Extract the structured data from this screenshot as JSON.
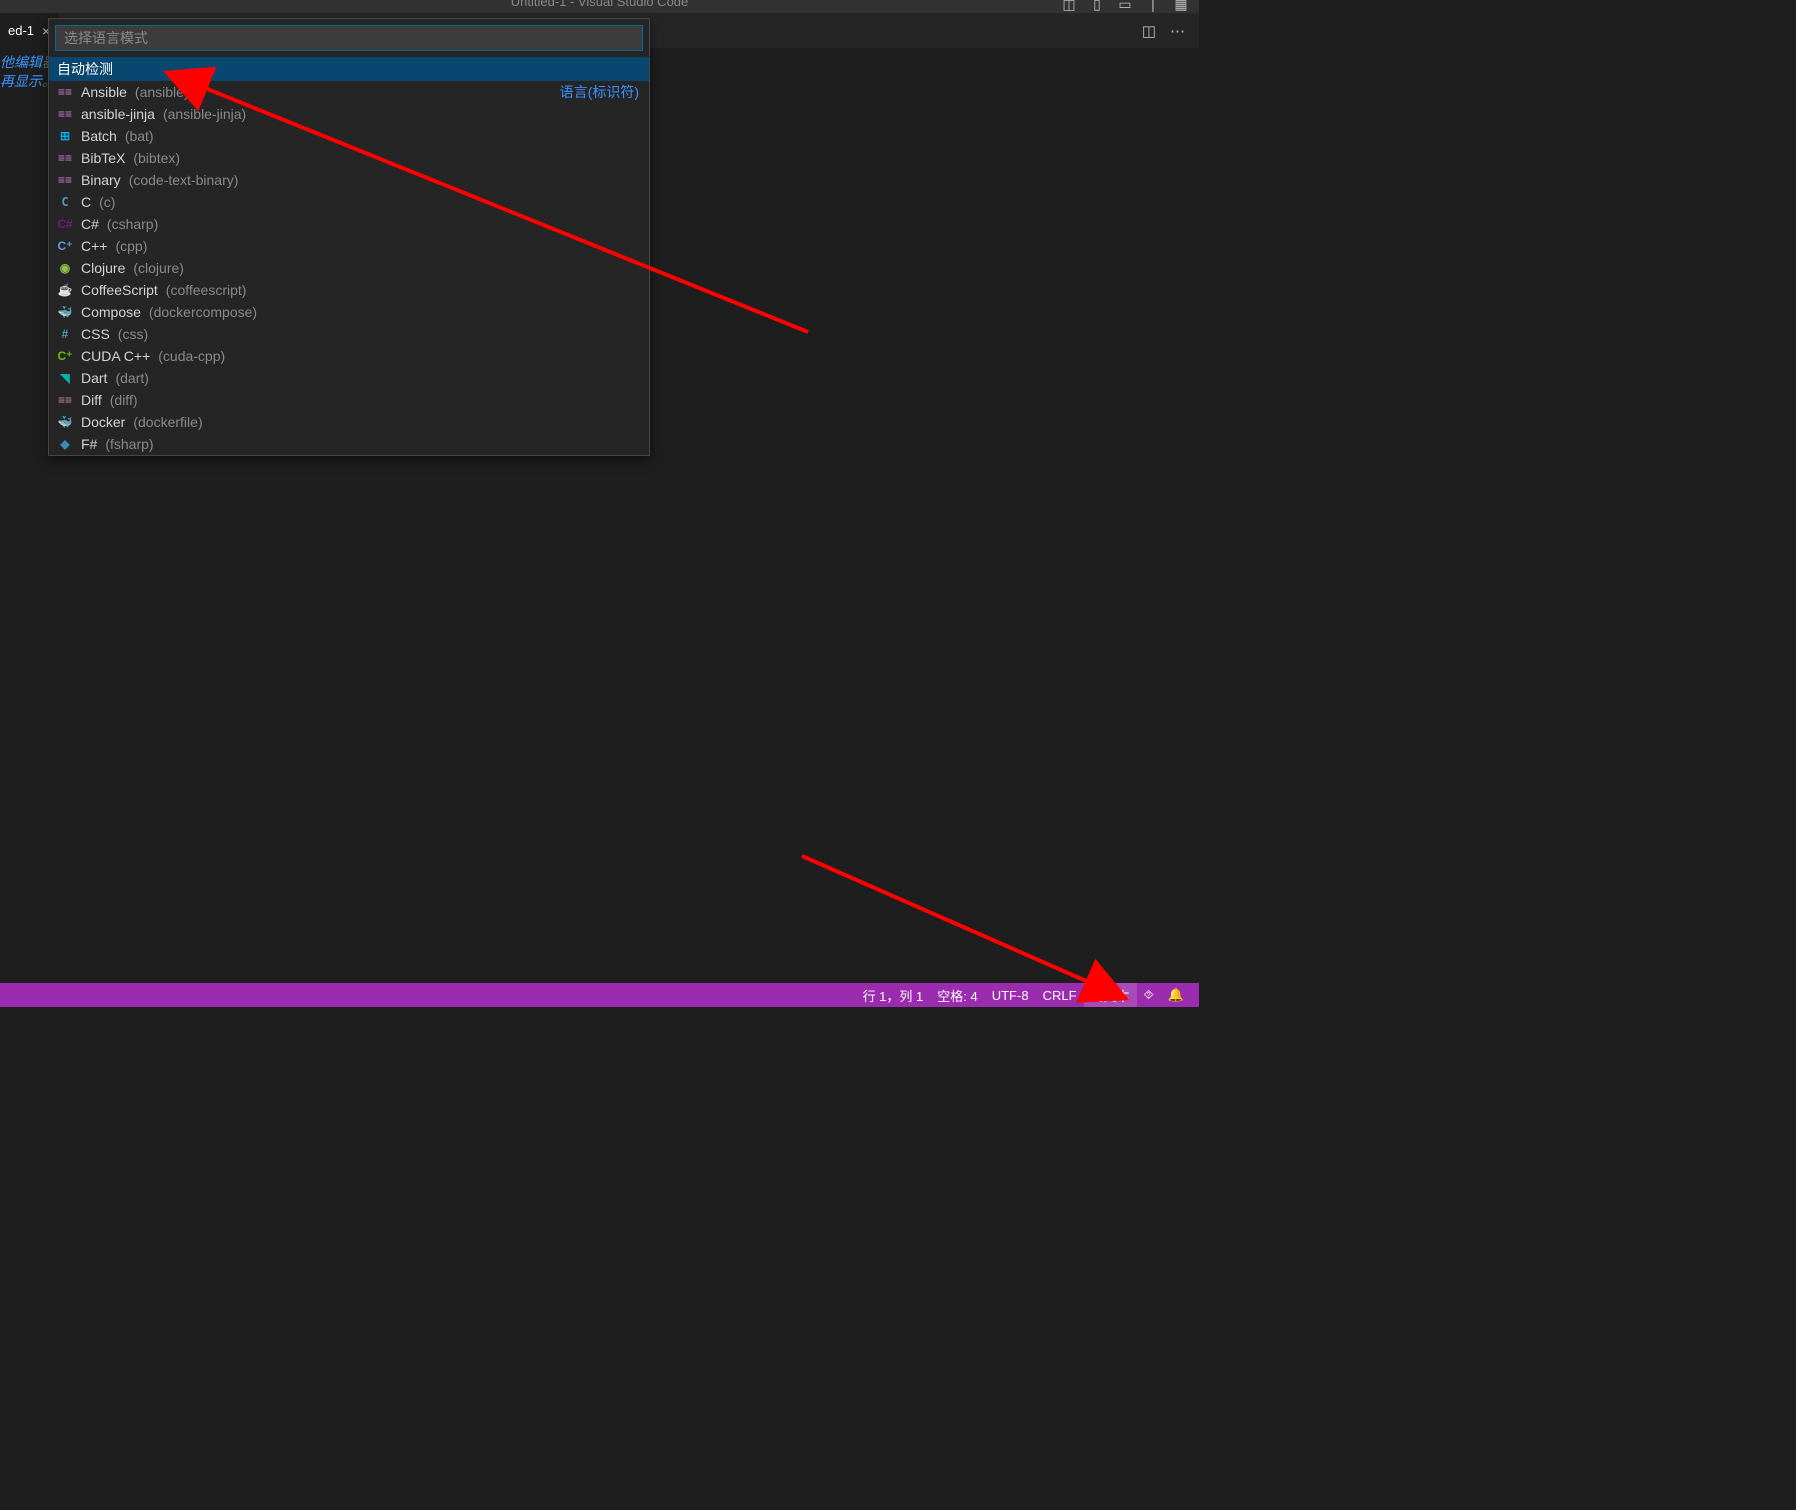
{
  "window": {
    "title": "Untitled-1 - Visual Studio Code"
  },
  "tab": {
    "name": "ed-1",
    "close": "×"
  },
  "editor_hint": {
    "line1_a": "他编辑",
    "line1_b": "器",
    "line2_a": "再显示",
    "line2_b": "。"
  },
  "quickpick": {
    "placeholder": "选择语言模式",
    "header": "自动检测",
    "right_label": "语言(标识符)",
    "items": [
      {
        "icon": "text",
        "name": "Ansible",
        "id": "(ansible)"
      },
      {
        "icon": "text",
        "name": "ansible-jinja",
        "id": "(ansible-jinja)"
      },
      {
        "icon": "bat",
        "name": "Batch",
        "id": "(bat)"
      },
      {
        "icon": "text",
        "name": "BibTeX",
        "id": "(bibtex)"
      },
      {
        "icon": "text",
        "name": "Binary",
        "id": "(code-text-binary)"
      },
      {
        "icon": "c",
        "name": "C",
        "id": "(c)"
      },
      {
        "icon": "csharp",
        "name": "C#",
        "id": "(csharp)"
      },
      {
        "icon": "cpp",
        "name": "C++",
        "id": "(cpp)"
      },
      {
        "icon": "clj",
        "name": "Clojure",
        "id": "(clojure)"
      },
      {
        "icon": "coffee",
        "name": "CoffeeScript",
        "id": "(coffeescript)"
      },
      {
        "icon": "docker",
        "name": "Compose",
        "id": "(dockercompose)"
      },
      {
        "icon": "css",
        "name": "CSS",
        "id": "(css)"
      },
      {
        "icon": "cuda",
        "name": "CUDA C++",
        "id": "(cuda-cpp)"
      },
      {
        "icon": "dart",
        "name": "Dart",
        "id": "(dart)"
      },
      {
        "icon": "text",
        "name": "Diff",
        "id": "(diff)"
      },
      {
        "icon": "docker",
        "name": "Docker",
        "id": "(dockerfile)"
      },
      {
        "icon": "fsharp",
        "name": "F#",
        "id": "(fsharp)"
      }
    ]
  },
  "status": {
    "cursor": "行 1，列 1",
    "spaces": "空格: 4",
    "encoding": "UTF-8",
    "eol": "CRLF",
    "language": "纯文本"
  },
  "icon_glyphs": {
    "text": "≡",
    "bat": "⊞",
    "c": "C",
    "csharp": "C#",
    "cpp": "C⁺",
    "clj": "◉",
    "coffee": "☕",
    "docker": "🐳",
    "css": "#",
    "cuda": "C⁺",
    "dart": "◥",
    "diff": "≡",
    "fsharp": "◆"
  }
}
